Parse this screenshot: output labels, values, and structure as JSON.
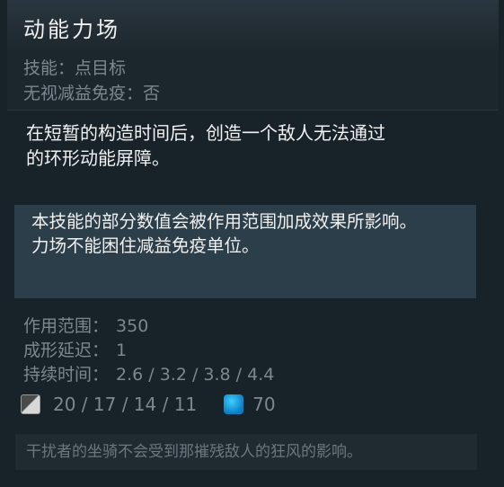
{
  "ability": {
    "title": "动能力场"
  },
  "meta": {
    "ability_type": "技能：点目标",
    "debuff_immunity": "无视减益免疫：否"
  },
  "description": {
    "line1": "在短暂的构造时间后，创造一个敌人无法通过",
    "line2": "的环形动能屏障。"
  },
  "notes": {
    "note1": "本技能的部分数值会被作用范围加成效果所影响。",
    "note2": "力场不能困住减益免疫单位。"
  },
  "stats": [
    {
      "label": "作用范围：",
      "value": "350"
    },
    {
      "label": "成形延迟：",
      "value": "1"
    },
    {
      "label": "持续时间：",
      "value": "2.6 / 3.2 / 3.8 / 4.4"
    }
  ],
  "costs": {
    "cooldown": "20 / 17 / 14 / 11",
    "mana": "70",
    "cooldown_icon": "cooldown-icon",
    "mana_icon": "mana-icon"
  },
  "lore": {
    "text": "干扰者的坐骑不会受到那摧残敌人的狂风的影响。"
  },
  "colors": {
    "background": "#182229",
    "note_background": "#2c3e49",
    "mana": "#1a9fe0"
  }
}
